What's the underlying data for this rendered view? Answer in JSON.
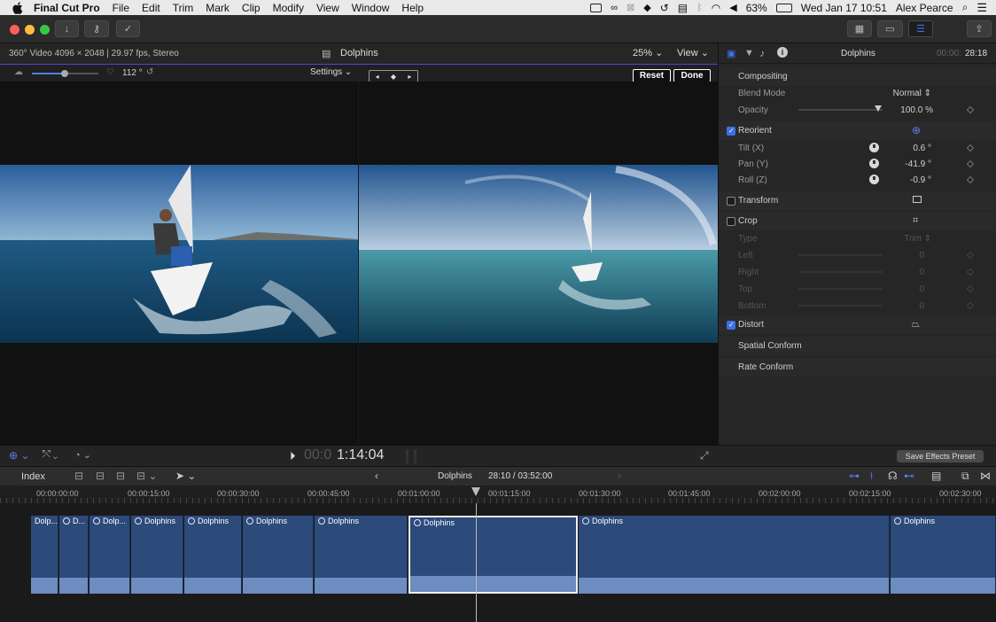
{
  "menubar": {
    "app_name": "Final Cut Pro",
    "items": [
      "File",
      "Edit",
      "Trim",
      "Mark",
      "Clip",
      "Modify",
      "View",
      "Window",
      "Help"
    ],
    "battery": "63%",
    "datetime": "Wed Jan 17  10:51",
    "user": "Alex Pearce"
  },
  "viewer": {
    "format_info": "360° Video 4096 × 2048 | 29.97 fps, Stereo",
    "clip_title": "Dolphins",
    "zoom": "25%",
    "view_label": "View",
    "angle_value": "112 °",
    "settings_label": "Settings",
    "reset_label": "Reset",
    "done_label": "Done",
    "timecode_dim": "00:0",
    "timecode": "1:14:04"
  },
  "inspector": {
    "title": "Dolphins",
    "duration_dim": "00:00:",
    "duration": "28:18",
    "compositing_label": "Compositing",
    "blend_mode_label": "Blend Mode",
    "blend_mode_value": "Normal",
    "opacity_label": "Opacity",
    "opacity_value": "100.0 %",
    "reorient_label": "Reorient",
    "tilt_label": "Tilt (X)",
    "tilt_value": "0.6 °",
    "pan_label": "Pan (Y)",
    "pan_value": "-41.9 °",
    "roll_label": "Roll (Z)",
    "roll_value": "-0.9 °",
    "transform_label": "Transform",
    "crop_label": "Crop",
    "type_label": "Type",
    "type_value": "Trim",
    "left_label": "Left",
    "right_label": "Right",
    "top_label": "Top",
    "bottom_label": "Bottom",
    "crop_zero": "0",
    "distort_label": "Distort",
    "spatial_conform_label": "Spatial Conform",
    "rate_conform_label": "Rate Conform",
    "save_preset_label": "Save Effects Preset"
  },
  "timeline": {
    "index_label": "Index",
    "project_name": "Dolphins",
    "position": "28:10 / 03:52:00",
    "ruler": [
      "00:00:00:00",
      "00:00:15:00",
      "00:00:30:00",
      "00:00:45:00",
      "00:01:00:00",
      "00:01:15:00",
      "00:01:30:00",
      "00:01:45:00",
      "00:02:00:00",
      "00:02:15:00",
      "00:02:30:00"
    ],
    "clips": [
      "Dolp...",
      "D...",
      "Dolp...",
      "Dolphins",
      "Dolphins",
      "Dolphins",
      "Dolphins",
      "Dolphins",
      "Dolphins",
      "Dolphins"
    ]
  },
  "colors": {
    "accent": "#5b3fd8",
    "clip": "#2c4a7a",
    "checkbox": "#3d6fe8"
  }
}
